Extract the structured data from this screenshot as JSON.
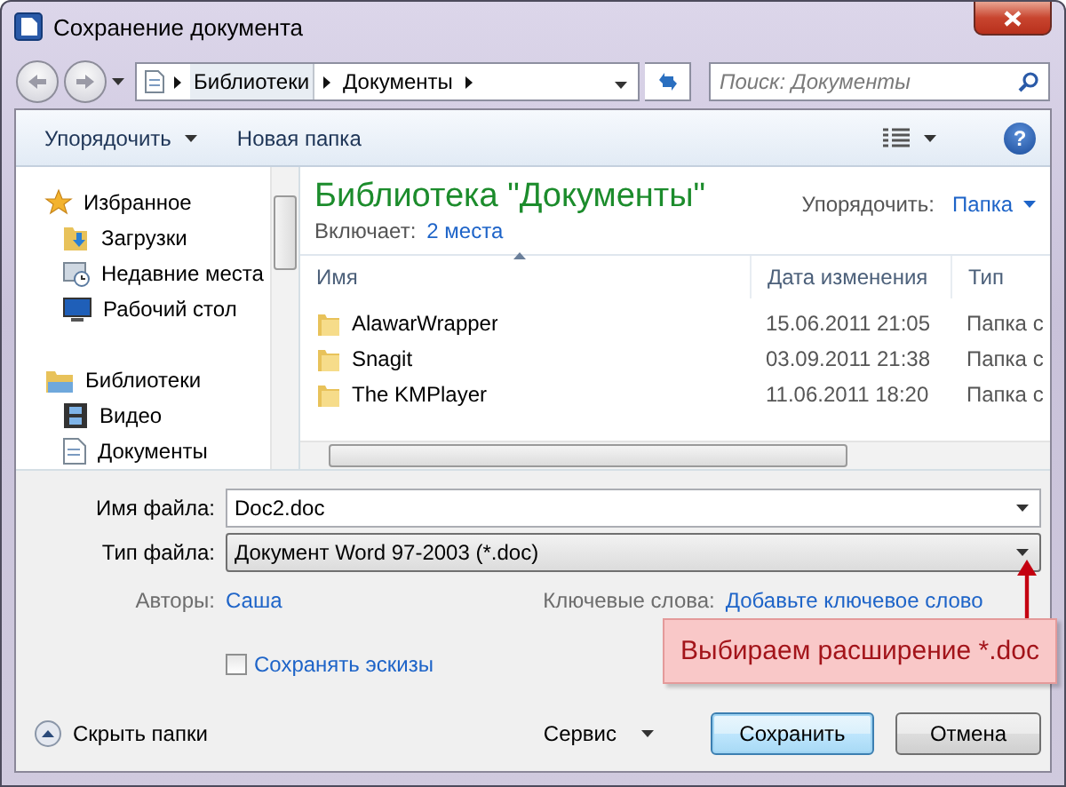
{
  "window": {
    "title": "Сохранение документа"
  },
  "address": {
    "crumbs": [
      "Библиотеки",
      "Документы"
    ]
  },
  "search": {
    "placeholder": "Поиск: Документы"
  },
  "toolbar": {
    "organize": "Упорядочить",
    "new_folder": "Новая папка",
    "help": "?"
  },
  "sidebar": {
    "groups": [
      {
        "label": "Избранное",
        "kind": "star",
        "children": [
          {
            "label": "Загрузки",
            "kind": "download"
          },
          {
            "label": "Недавние места",
            "kind": "recent"
          },
          {
            "label": "Рабочий стол",
            "kind": "desktop"
          }
        ]
      },
      {
        "label": "Библиотеки",
        "kind": "library",
        "children": [
          {
            "label": "Видео",
            "kind": "video"
          },
          {
            "label": "Документы",
            "kind": "document"
          }
        ]
      }
    ]
  },
  "library": {
    "title": "Библиотека \"Документы\"",
    "includes_label": "Включает:",
    "includes_link": "2 места",
    "arrange_label": "Упорядочить:",
    "arrange_value": "Папка"
  },
  "table": {
    "columns": [
      "Имя",
      "Дата изменения",
      "Тип"
    ],
    "rows": [
      {
        "name": "AlawarWrapper",
        "date": "15.06.2011 21:05",
        "type": "Папка с"
      },
      {
        "name": "Snagit",
        "date": "03.09.2011 21:38",
        "type": "Папка с"
      },
      {
        "name": "The KMPlayer",
        "date": "11.06.2011 18:20",
        "type": "Папка с"
      }
    ]
  },
  "form": {
    "filename_label": "Имя файла:",
    "filename": "Doc2.doc",
    "filetype_label": "Тип файла:",
    "filetype": "Документ Word 97-2003 (*.doc)",
    "authors_label": "Авторы:",
    "authors": "Саша",
    "keywords_label": "Ключевые слова:",
    "keywords_placeholder": "Добавьте ключевое слово",
    "thumbnails": {
      "label": "Сохранять эскизы",
      "checked": false
    }
  },
  "footer": {
    "hide_folders": "Скрыть папки",
    "service": "Сервис",
    "buttons": [
      {
        "label": "Сохранить",
        "default": true
      },
      {
        "label": "Отмена",
        "default": false
      }
    ]
  },
  "callout": {
    "text": "Выбираем расширение *.doc"
  }
}
